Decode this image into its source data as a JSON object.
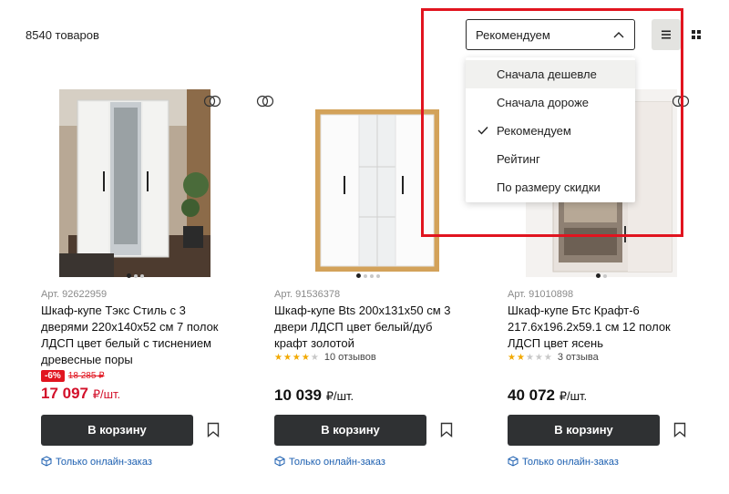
{
  "listing": {
    "count_label": "8540 товаров"
  },
  "sort": {
    "selected": "Рекомендуем",
    "options": [
      {
        "label": "Сначала дешевле",
        "hovered": true
      },
      {
        "label": "Сначала дороже"
      },
      {
        "label": "Рекомендуем",
        "checked": true
      },
      {
        "label": "Рейтинг"
      },
      {
        "label": "По размеру скидки"
      }
    ]
  },
  "view": {
    "list_icon": "list-view-icon",
    "grid_icon": "grid-view-icon",
    "active": "list"
  },
  "colors": {
    "accent_red": "#e1141f",
    "price_red": "#d3102a",
    "button_dark": "#2f3133",
    "link_blue": "#1c5fb0",
    "star": "#f2a900"
  },
  "products": [
    {
      "art": "Арт. 92622959",
      "title": "Шкаф-купе Тэкс Стиль с 3 дверями 220х140х52 см 7 полок ЛДСП цвет белый с тиснением древесные поры",
      "discount": "-6%",
      "old_price": "18 285 ₽",
      "price": "17 097",
      "unit": "₽/шт.",
      "cart_label": "В корзину",
      "online_label": "Только онлайн-заказ",
      "image_dots": 3
    },
    {
      "art": "Арт. 91536378",
      "title": "Шкаф-купе Bts 200x131x50 см 3 двери ЛДСП цвет белый/дуб крафт золотой",
      "rating": 4.5,
      "reviews": "10 отзывов",
      "price": "10 039",
      "unit": "₽/шт.",
      "cart_label": "В корзину",
      "online_label": "Только онлайн-заказ",
      "image_dots": 4
    },
    {
      "art": "Арт. 91010898",
      "title": "Шкаф-купе Бтс Крафт-6 217.6x196.2x59.1 см 12 полок ЛДСП цвет ясень",
      "rating": 2,
      "reviews": "3 отзыва",
      "price": "40 072",
      "unit": "₽/шт.",
      "cart_label": "В корзину",
      "online_label": "Только онлайн-заказ",
      "image_dots": 2
    }
  ]
}
